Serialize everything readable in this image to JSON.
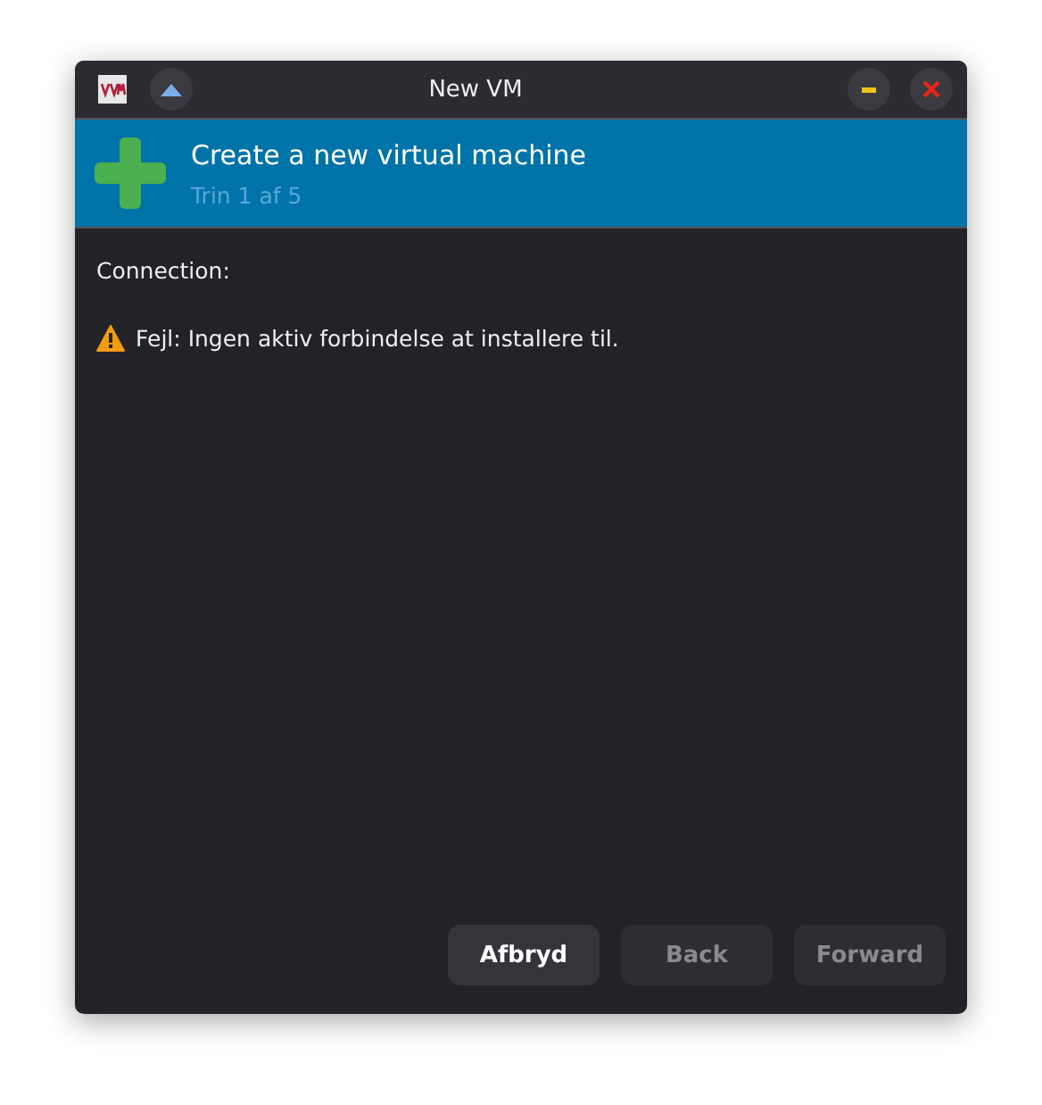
{
  "window": {
    "title": "New VM"
  },
  "header": {
    "title": "Create a new virtual machine",
    "step": "Trin 1 af 5"
  },
  "connection": {
    "label": "Connection:"
  },
  "error": {
    "message": "Fejl: Ingen aktiv forbindelse at installere til."
  },
  "buttons": [
    {
      "label": "Afbryd",
      "disabled": false
    },
    {
      "label": "Back",
      "disabled": true
    },
    {
      "label": "Forward",
      "disabled": true
    }
  ]
}
